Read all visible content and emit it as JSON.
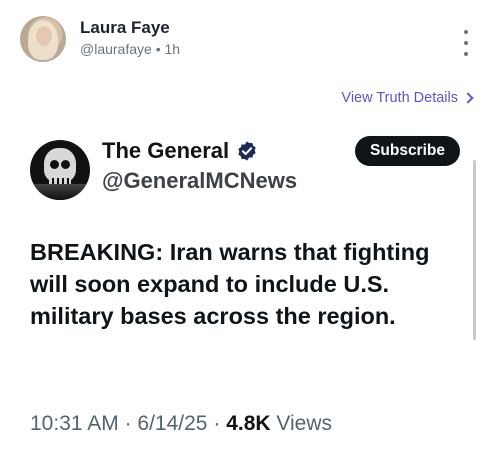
{
  "post": {
    "author_name": "Laura Faye",
    "handle": "@laurafaye",
    "separator": "•",
    "time": "1h",
    "details_link": "View Truth Details"
  },
  "embed": {
    "name": "The General",
    "handle": "@GeneralMCNews",
    "subscribe_label": "Subscribe",
    "text": "BREAKING: Iran warns that fighting will soon expand to include U.S. military bases across the region.",
    "time": "10:31 AM",
    "date": "6/14/25",
    "dot": "·",
    "views_count": "4.8K",
    "views_label": "Views"
  },
  "icons": {
    "more": "more-vertical-icon",
    "verified": "verified-badge-icon",
    "chevron": "chevron-right-icon"
  },
  "colors": {
    "link": "#5b57c9",
    "verified": "#1d2a57",
    "button_bg": "#0f1419"
  }
}
